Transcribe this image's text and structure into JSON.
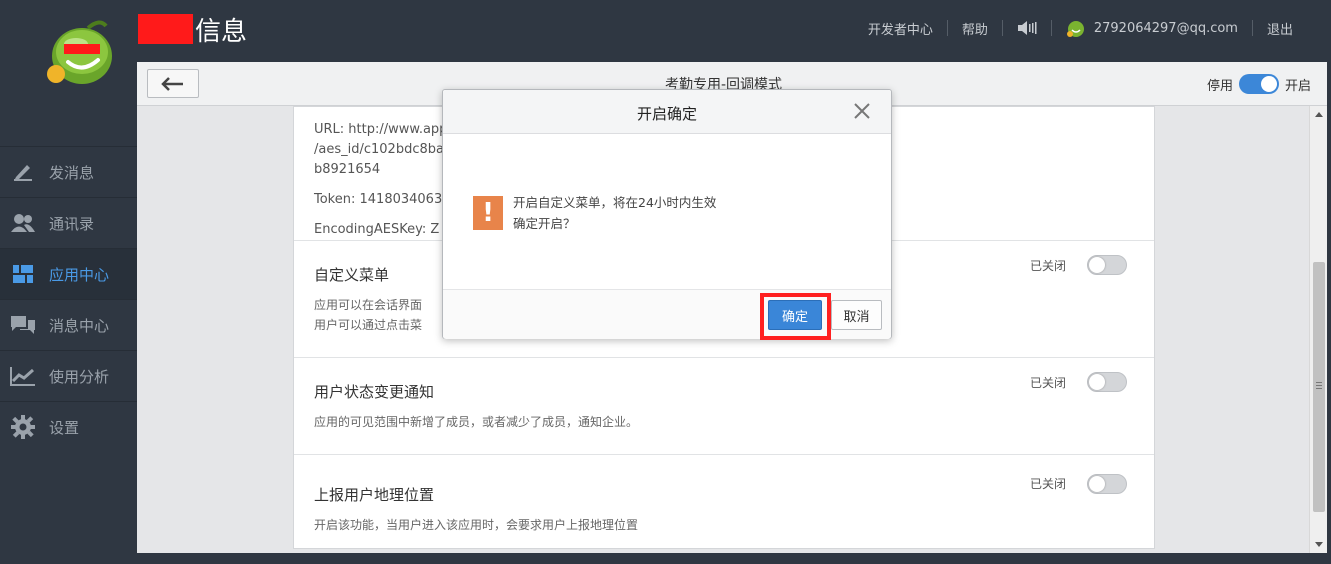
{
  "brand": {
    "title": "信息"
  },
  "topnav": {
    "developer_center": "开发者中心",
    "help": "帮助",
    "account": "2792064297@qq.com",
    "logout": "退出"
  },
  "sidebar": {
    "items": [
      {
        "label": "发消息",
        "icon": "pen-icon"
      },
      {
        "label": "通讯录",
        "icon": "contacts-icon"
      },
      {
        "label": "应用中心",
        "icon": "apps-icon",
        "active": true
      },
      {
        "label": "消息中心",
        "icon": "messages-icon"
      },
      {
        "label": "使用分析",
        "icon": "chart-icon"
      },
      {
        "label": "设置",
        "icon": "gear-icon"
      }
    ]
  },
  "app": {
    "title": "考勤专用-回调模式",
    "switch_off_label": "停用",
    "switch_on_label": "开启"
  },
  "info": {
    "url_prefix": "URL: http://www.app",
    "url_suffix": "/aes_id/c102bdc8bab1ad035cd8ad9e",
    "url_line2": "b8921654",
    "token": "Token: 1418034063",
    "aeskey": "EncodingAESKey: Z"
  },
  "sections": [
    {
      "title": "自定义菜单",
      "desc1": "应用可以在会话界面",
      "desc2": "用户可以通过点击菜",
      "status": "已关闭"
    },
    {
      "title": "用户状态变更通知",
      "desc1": "应用的可见范围中新增了成员，或者减少了成员，通知企业。",
      "status": "已关闭"
    },
    {
      "title": "上报用户地理位置",
      "desc1": "开启该功能，当用户进入该应用时，会要求用户上报地理位置",
      "status": "已关闭"
    }
  ],
  "modal": {
    "title": "开启确定",
    "line1": "开启自定义菜单，将在24小时内生效",
    "line2": "确定开启？",
    "ok_label": "确定",
    "cancel_label": "取消"
  },
  "colors": {
    "accent": "#3a86d8",
    "warning": "#e8844a",
    "highlight": "#ff2020"
  }
}
